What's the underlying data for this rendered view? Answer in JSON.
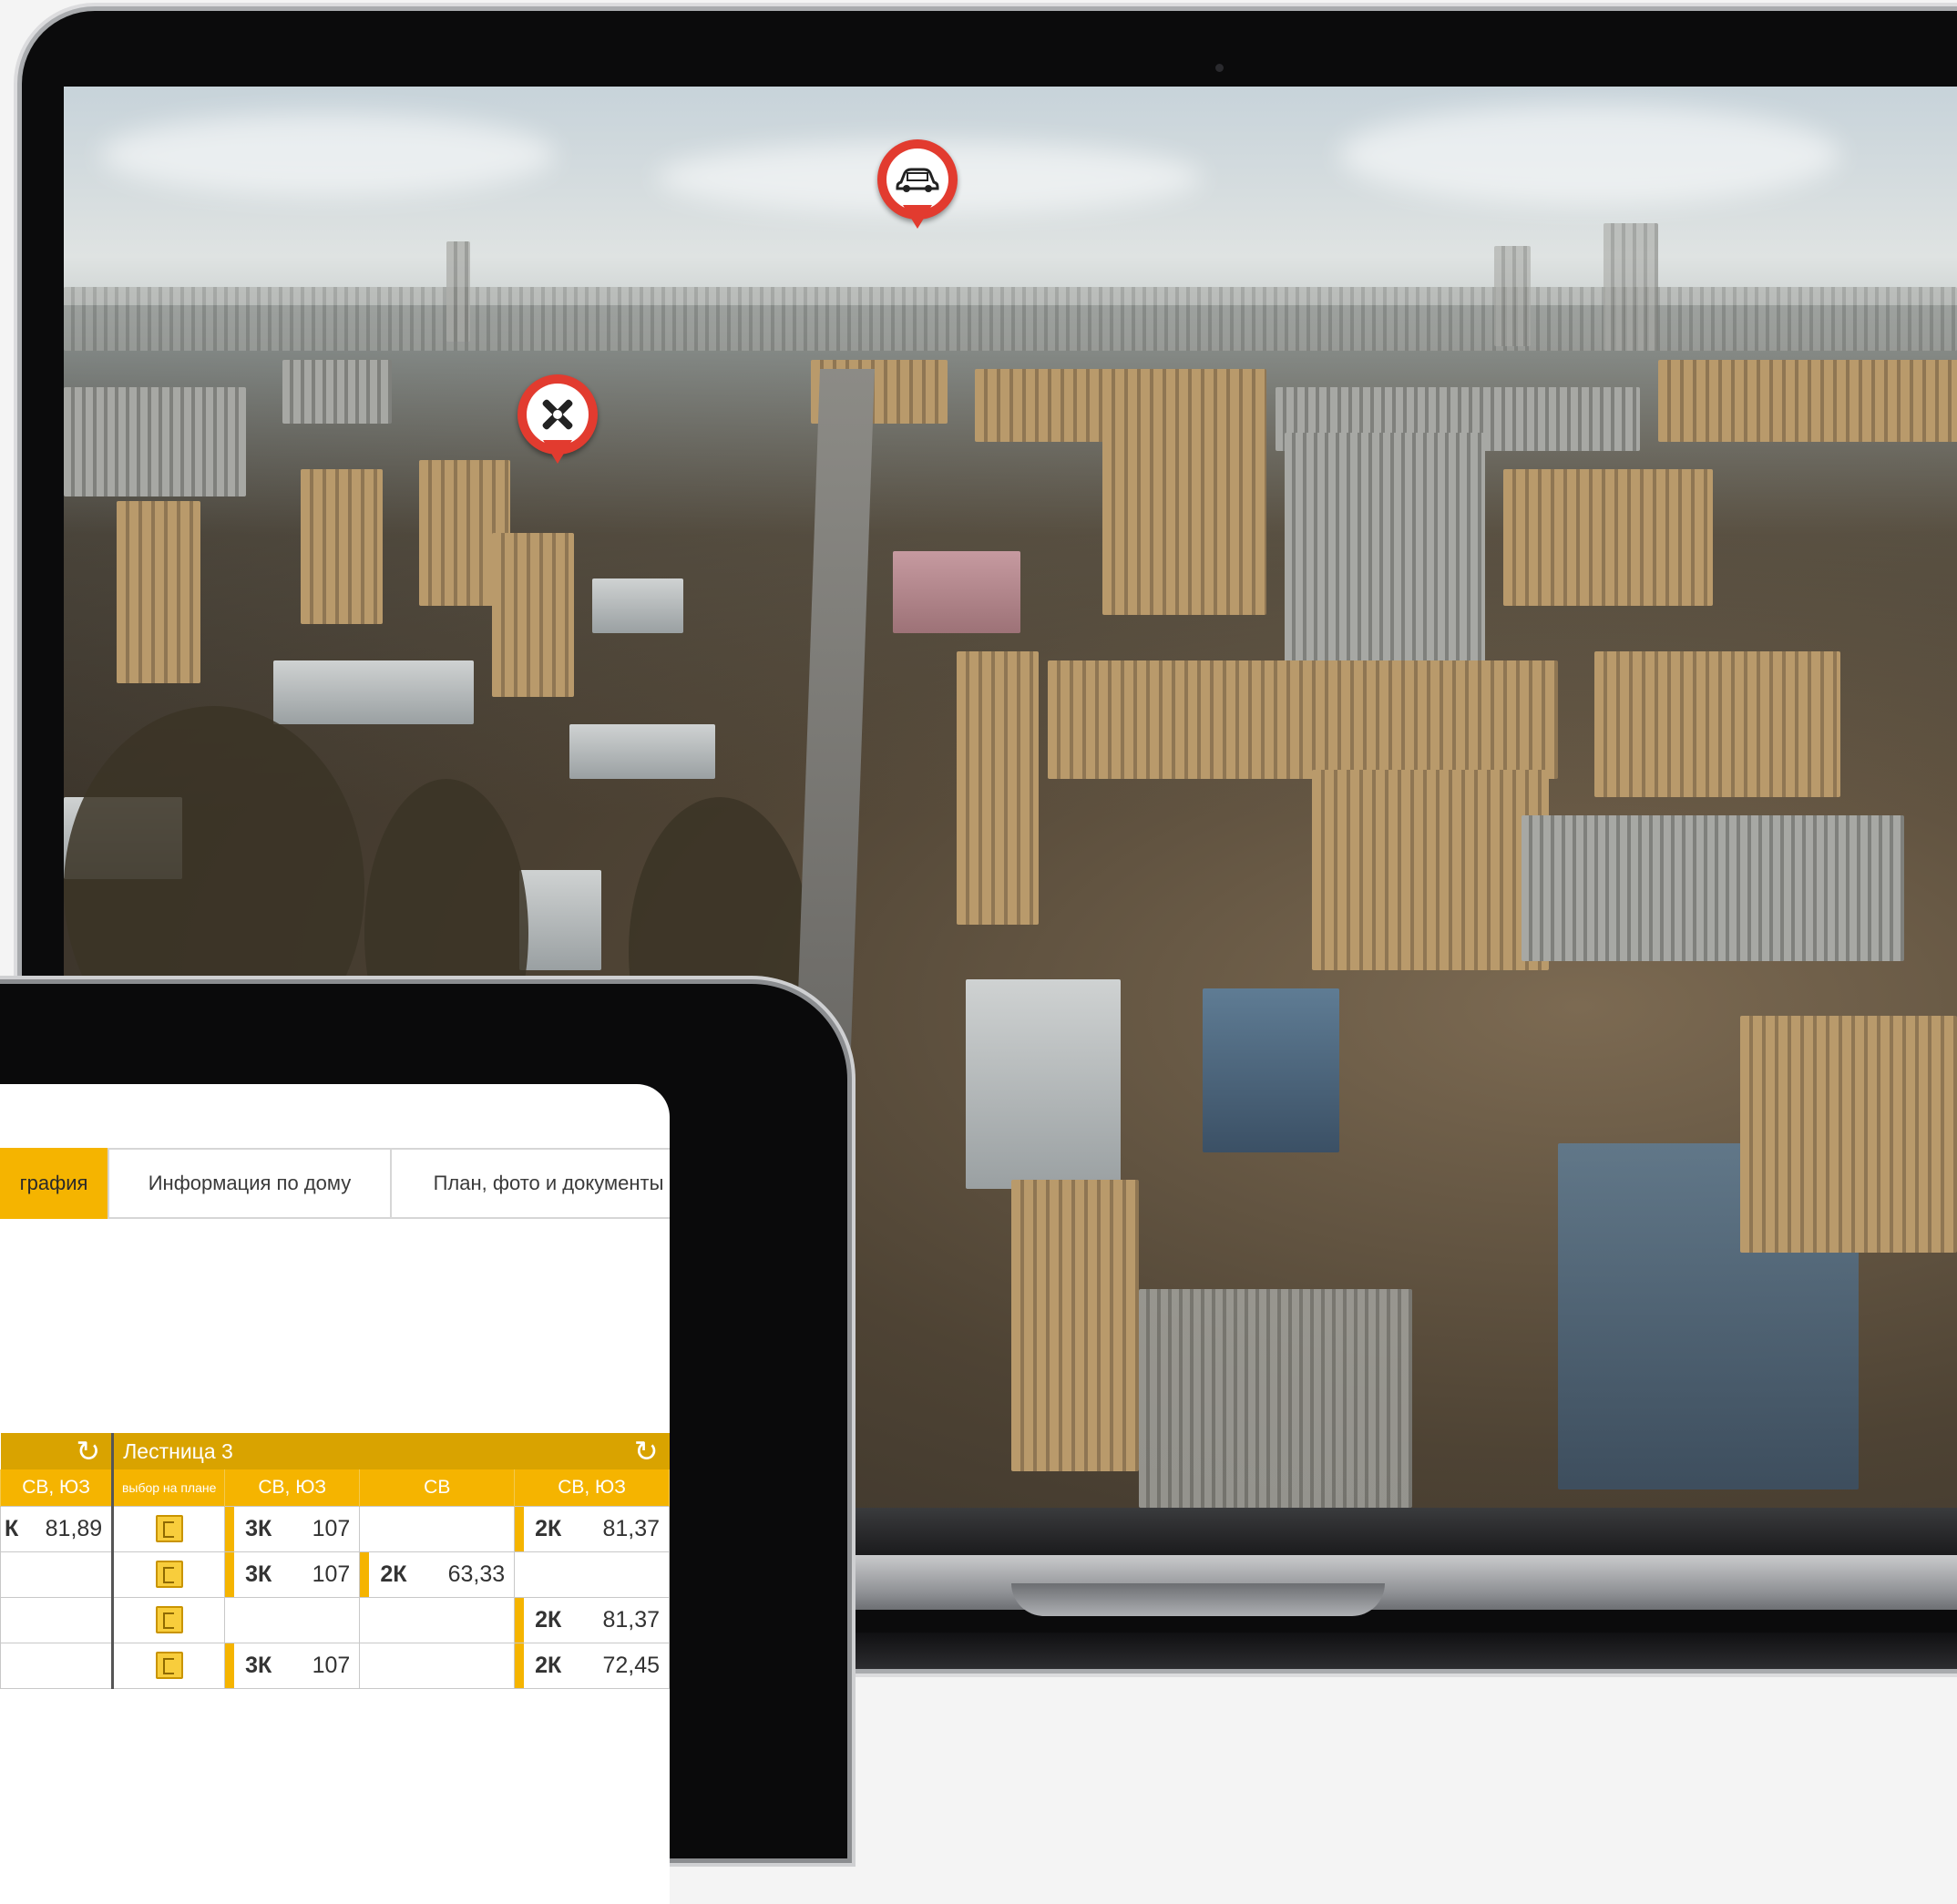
{
  "scene": {
    "pins": [
      {
        "icon": "car-icon"
      },
      {
        "icon": "tools-icon"
      }
    ]
  },
  "tablet": {
    "tabs": [
      {
        "label": "графия",
        "active": true
      },
      {
        "label": "Информация по дому",
        "active": false
      },
      {
        "label": "План, фото и документы",
        "active": false
      }
    ],
    "stair_label": "Лестница 3",
    "left_header": "СВ, ЮЗ",
    "columns": [
      "выбор на плане",
      "СВ, ЮЗ",
      "СВ",
      "СВ, ЮЗ"
    ],
    "left_cell": {
      "rooms": "К",
      "area": "81,89"
    },
    "rows": [
      [
        {
          "rooms": "3К",
          "area": "107"
        },
        null,
        {
          "rooms": "2К",
          "area": "81,37"
        }
      ],
      [
        {
          "rooms": "3К",
          "area": "107"
        },
        {
          "rooms": "2К",
          "area": "63,33"
        },
        null
      ],
      [
        null,
        null,
        {
          "rooms": "2К",
          "area": "81,37"
        }
      ],
      [
        {
          "rooms": "3К",
          "area": "107"
        },
        null,
        {
          "rooms": "2К",
          "area": "72,45"
        }
      ]
    ],
    "colors": {
      "accent": "#f5b400",
      "header_dark": "#d9a300"
    }
  }
}
